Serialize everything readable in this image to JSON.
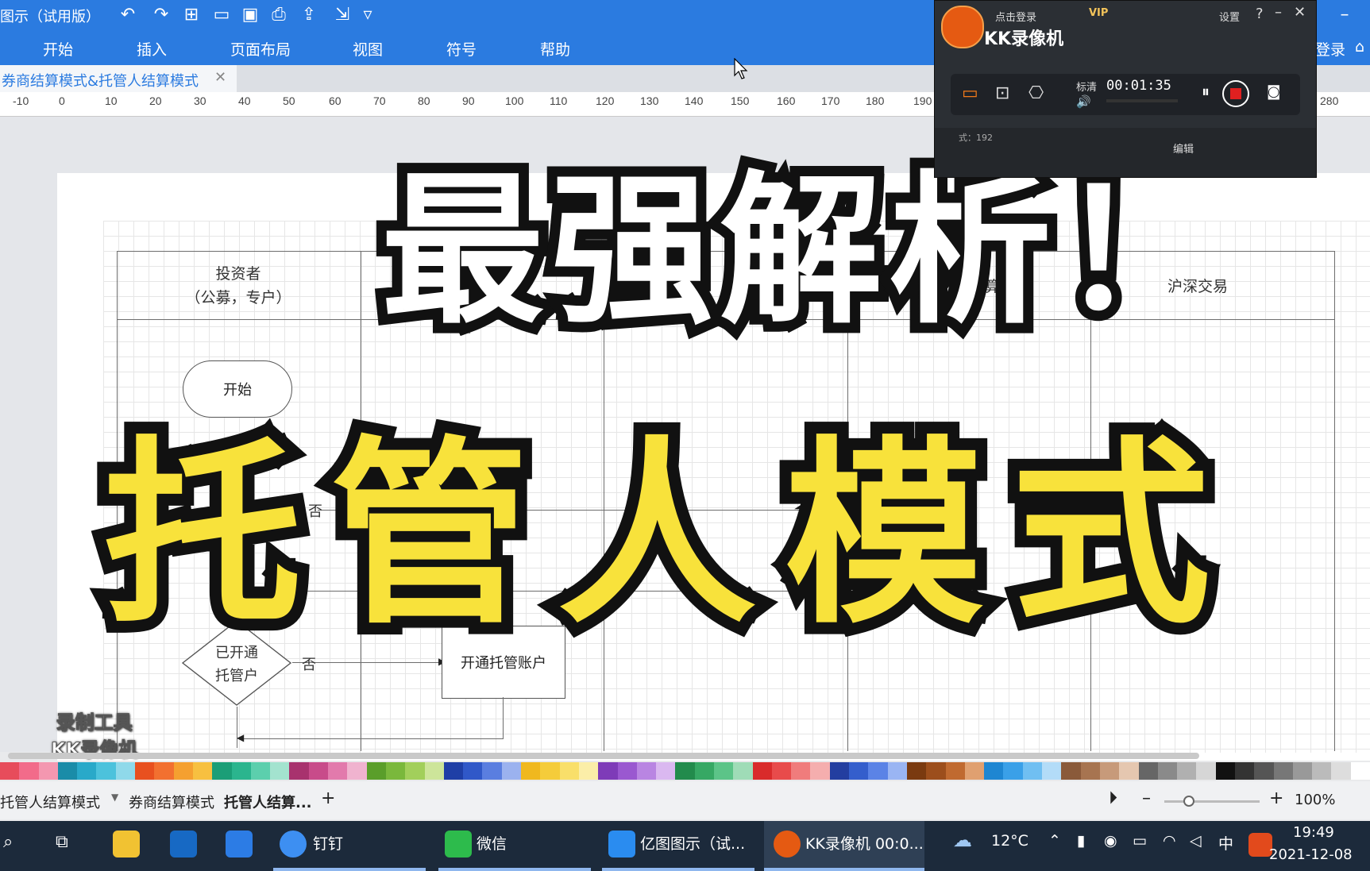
{
  "app": {
    "title": "图示（试用版）",
    "menu": [
      "开始",
      "插入",
      "页面布局",
      "视图",
      "符号",
      "帮助"
    ],
    "login": "登录",
    "doc_tab": "券商结算模式&托管人结算模式"
  },
  "ruler": [
    "-10",
    "0",
    "10",
    "20",
    "30",
    "40",
    "50",
    "60",
    "70",
    "80",
    "90",
    "100",
    "110",
    "120",
    "130",
    "140",
    "150",
    "160",
    "170",
    "180",
    "190",
    "280"
  ],
  "diagram": {
    "lane_headers": [
      "投资者\n（公募，专户）",
      "结算",
      "沪深交易"
    ],
    "start": "开始",
    "no_1": "否",
    "decision": "已开通\n托管户",
    "no_2": "否",
    "process": "开通托管账户"
  },
  "overlay": {
    "headline": "最强解析！",
    "subline": "托管人模式",
    "watermark_line1": "录制工具",
    "watermark_line2": "KK录像机"
  },
  "recorder": {
    "login": "点击登录",
    "vip": "VIP",
    "settings": "设置",
    "help": "?",
    "app_name": "KK录像机",
    "quality": "标清",
    "time": "00:01:35",
    "format": "式：192",
    "edit": "编辑"
  },
  "page_tabs": {
    "tab1": "托管人结算模式",
    "tab2": "券商结算模式",
    "tab3": "托管人结算...",
    "add": "+",
    "zoom": "100%"
  },
  "palette": [
    "#e74c5b",
    "#f26b8a",
    "#f497b0",
    "#1a8ca8",
    "#29a9c9",
    "#4cc2dc",
    "#8fd9ea",
    "#e8501f",
    "#f27030",
    "#f5a030",
    "#f7c040",
    "#1b9e77",
    "#2bb58e",
    "#5ccfad",
    "#a3e3cf",
    "#a8326e",
    "#c84b8a",
    "#e27aac",
    "#f0b3cf",
    "#5a9e2a",
    "#7ab83c",
    "#a2cf5b",
    "#cde59a",
    "#1f3fa6",
    "#3058c8",
    "#5a7ee0",
    "#9bb2ef",
    "#f0b81e",
    "#f5cc3a",
    "#f9df6a",
    "#fbeea8",
    "#7e3bb8",
    "#9a58d0",
    "#b985e2",
    "#dab8f0",
    "#228b4c",
    "#36a864",
    "#5cc488",
    "#9fdcb7",
    "#d92b2b",
    "#e84b4b",
    "#f07c7c",
    "#f5aeae",
    "#233ea0",
    "#345ecc",
    "#5b83e6",
    "#9ab5f3",
    "#7a3a10",
    "#9c4e1c",
    "#c06a30",
    "#e0a070",
    "#1e86d2",
    "#3aa0e8",
    "#70bff2",
    "#b3dcf8",
    "#8a5a3a",
    "#a77450",
    "#c79a7a",
    "#e5c7b0",
    "#666666",
    "#8a8a8a",
    "#b0b0b0",
    "#d6d6d6",
    "#111111",
    "#333333",
    "#555555",
    "#777777",
    "#999999",
    "#bbbbbb",
    "#dddddd",
    "#ffffff"
  ],
  "taskbar": {
    "dingtalk": "钉钉",
    "wechat": "微信",
    "yitu": "亿图图示（试...",
    "kk": "KK录像机 00:0...",
    "weather": "12°C",
    "ime": "中",
    "time": "19:49",
    "date": "2021-12-08"
  }
}
